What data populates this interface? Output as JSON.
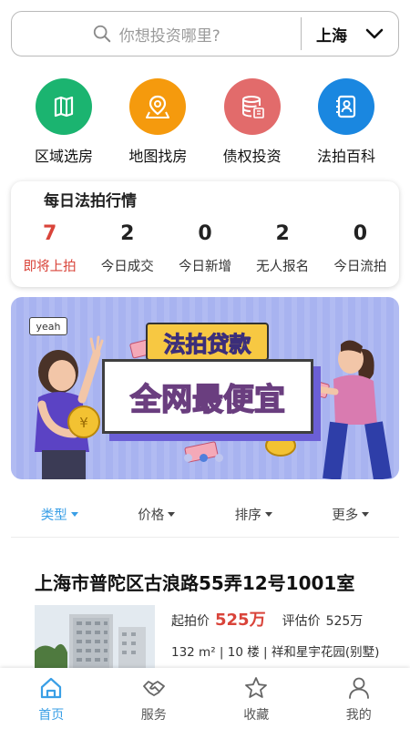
{
  "search": {
    "placeholder": "你想投资哪里?",
    "city": "上海"
  },
  "quick_nav": [
    {
      "label": "区域选房",
      "icon": "map-icon",
      "color": "#1bb470"
    },
    {
      "label": "地图找房",
      "icon": "location-pin-icon",
      "color": "#f59a0d"
    },
    {
      "label": "债权投资",
      "icon": "database-debt-icon",
      "color": "#e26b6b"
    },
    {
      "label": "法拍百科",
      "icon": "contact-book-icon",
      "color": "#1a87e0"
    }
  ],
  "daily_stats": {
    "title": "每日法拍行情",
    "items": [
      {
        "value": "7",
        "label": "即将上拍",
        "highlight": true
      },
      {
        "value": "2",
        "label": "今日成交"
      },
      {
        "value": "0",
        "label": "今日新增"
      },
      {
        "value": "2",
        "label": "无人报名"
      },
      {
        "value": "0",
        "label": "今日流拍"
      }
    ]
  },
  "banner": {
    "headline_top": "法拍贷款",
    "headline_main": "全网最便宜",
    "bubble": "yeah",
    "slide_count": 3,
    "active_slide": 2
  },
  "filters": [
    {
      "label": "类型",
      "active": true
    },
    {
      "label": "价格"
    },
    {
      "label": "排序"
    },
    {
      "label": "更多"
    }
  ],
  "listing": {
    "title": "上海市普陀区古浪路55弄12号1001室",
    "start_price_label": "起拍价",
    "start_price": "525万",
    "appraisal_label": "评估价",
    "appraisal_price": "525万",
    "specs": "132 m² | 10 楼 | 祥和星宇花园(别墅)"
  },
  "tabs": [
    {
      "label": "首页",
      "icon": "home-icon",
      "active": true
    },
    {
      "label": "服务",
      "icon": "handshake-icon"
    },
    {
      "label": "收藏",
      "icon": "star-icon"
    },
    {
      "label": "我的",
      "icon": "user-icon"
    }
  ],
  "colors": {
    "accent": "#3a9fe6",
    "price_red": "#d9443a",
    "banner_bg": "#a8b3f0"
  }
}
